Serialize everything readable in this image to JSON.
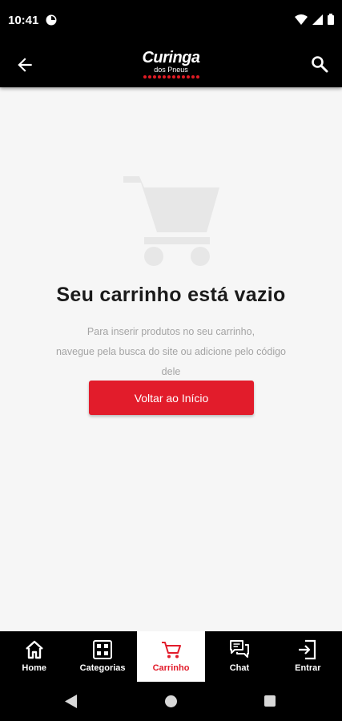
{
  "status_bar": {
    "time": "10:41"
  },
  "header": {
    "logo_main": "Curinga",
    "logo_sub": "dos Pneus"
  },
  "empty_state": {
    "title": "Seu carrinho está vazio",
    "description_line1": "Para inserir produtos no seu carrinho,",
    "description_line2": "navegue pela busca do site ou adicione pelo código",
    "description_line3": "dele",
    "button_label": "Voltar ao Início"
  },
  "bottom_nav": {
    "home": "Home",
    "categories": "Categorias",
    "cart": "Carrinho",
    "chat": "Chat",
    "login": "Entrar"
  },
  "colors": {
    "accent": "#e21c2b",
    "header_bg": "#000000",
    "page_bg": "#f6f6f6"
  }
}
